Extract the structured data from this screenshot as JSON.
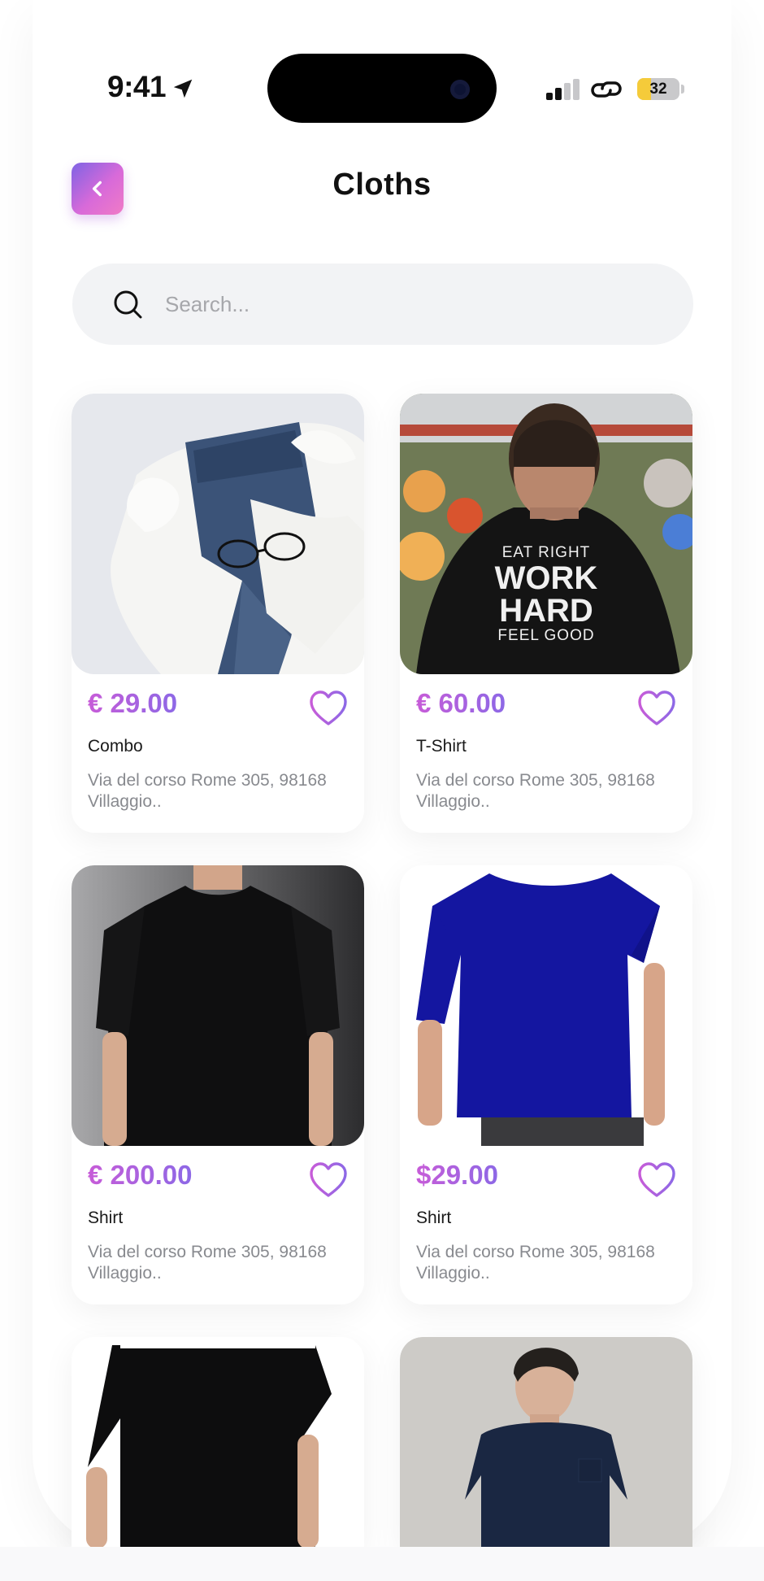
{
  "status_bar": {
    "time": "9:41",
    "battery_level": "32",
    "battery_fraction": 0.32,
    "icons": [
      "location-arrow-icon",
      "signal-icon",
      "link-icon",
      "battery-icon"
    ]
  },
  "header": {
    "title": "Cloths",
    "back_icon": "chevron-left-icon"
  },
  "search": {
    "placeholder": "Search...",
    "value": "",
    "icon": "search-icon"
  },
  "colors": {
    "accent_start": "#c75cd8",
    "accent_end": "#8d68e6",
    "search_bg": "#f2f3f5",
    "muted_text": "#888a8f"
  },
  "products": [
    {
      "price": "€ 29.00",
      "name": "Combo",
      "address": "Via del corso Rome 305, 98168 Villaggio..",
      "image": "jeans-sweater-glasses-photo"
    },
    {
      "price": "€ 60.00",
      "name": "T-Shirt",
      "address": "Via del corso Rome 305, 98168 Villaggio..",
      "image": "man-back-black-tshirt-photo"
    },
    {
      "price": "€ 200.00",
      "name": "Shirt",
      "address": "Via del corso Rome 305, 98168 Villaggio..",
      "image": "black-tshirt-model-photo"
    },
    {
      "price": "$29.00",
      "name": "Shirt",
      "address": "Via del corso Rome 305, 98168 Villaggio..",
      "image": "blue-tshirt-model-photo"
    },
    {
      "image": "black-tshirt-back-photo"
    },
    {
      "image": "navy-tshirt-model-photo"
    }
  ],
  "tshirt_print": {
    "line1": "EAT RIGHT",
    "line2": "WORK",
    "line3": "HARD",
    "line4": "FEEL GOOD"
  }
}
